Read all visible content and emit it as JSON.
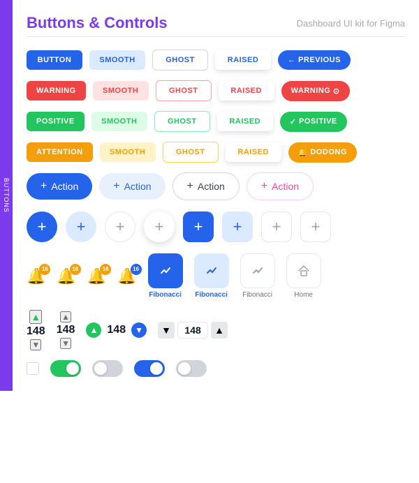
{
  "side_tab": {
    "label": "BUTTONS"
  },
  "header": {
    "title": "Buttons & Controls",
    "subtitle": "Dashboard UI kit for Figma"
  },
  "rows": {
    "row1": {
      "btn1": "BUTTON",
      "btn2": "SMOOTH",
      "btn3": "GHOST",
      "btn4": "RAISED",
      "btn5": "← PREVIOUS"
    },
    "row2": {
      "btn1": "WARNING",
      "btn2": "SMOOTH",
      "btn3": "GHOST",
      "btn4": "RAISED",
      "btn5": "WARNING"
    },
    "row3": {
      "btn1": "POSITIVE",
      "btn2": "SMOOTH",
      "btn3": "GHOST",
      "btn4": "RAISED",
      "btn5": "POSITIVE"
    },
    "row4": {
      "btn1": "ATTENTION",
      "btn2": "SMOOTH",
      "btn3": "GHOST",
      "btn4": "RAISED",
      "btn5": "DODONG"
    }
  },
  "actions": {
    "btn1": "Action",
    "btn2": "Action",
    "btn3": "Action",
    "btn4": "Action"
  },
  "fibonacci": {
    "label1": "Fibonacci",
    "label2": "Fibonacci",
    "label3": "Fibonacci",
    "label4": "Home"
  },
  "steppers": {
    "val1": "148",
    "val2": "148",
    "val3": "148",
    "val4": "148"
  },
  "notif_badge": "16"
}
